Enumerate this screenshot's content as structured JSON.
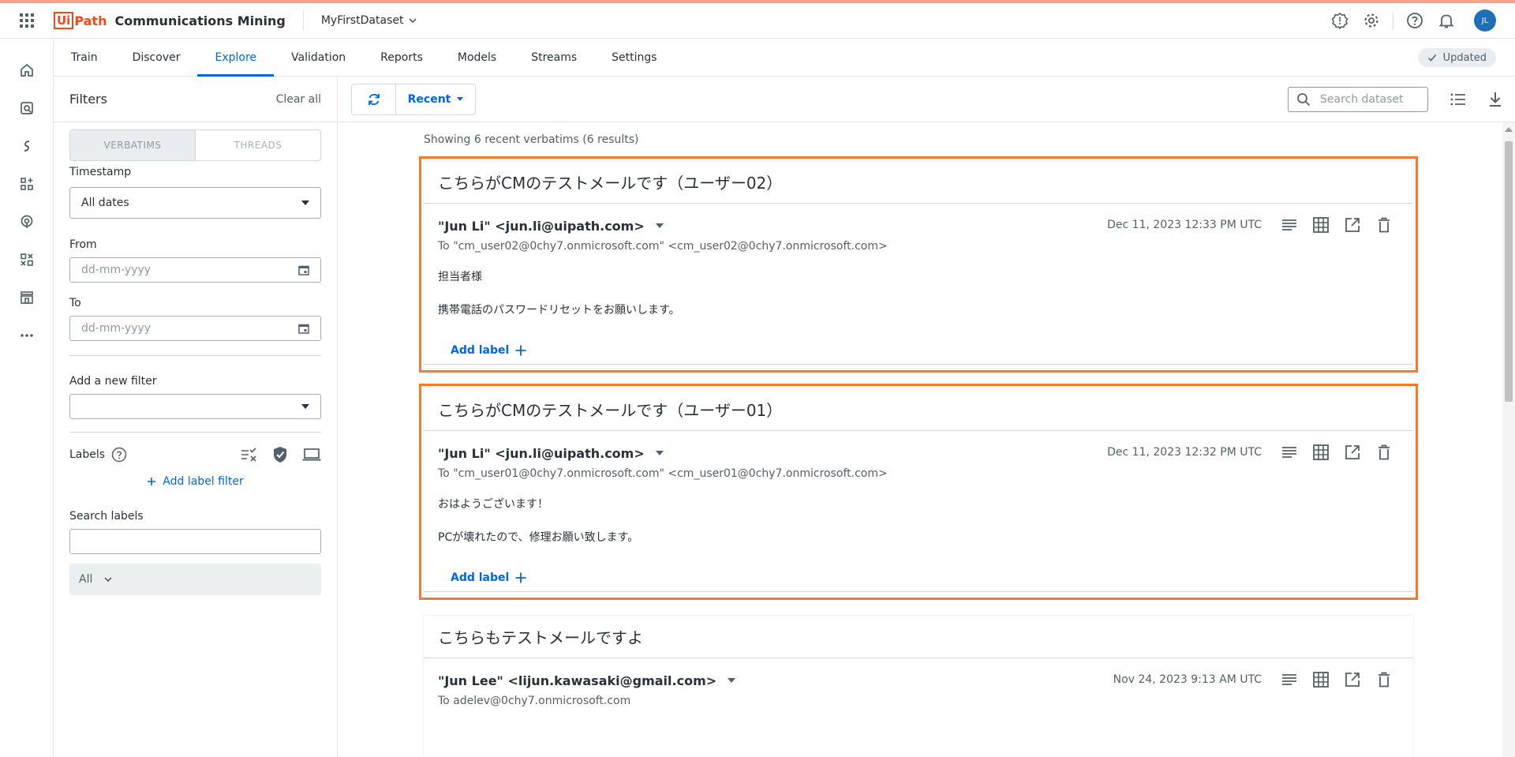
{
  "header": {
    "product_ui": "Ui",
    "product_path": "Path",
    "product_name": "Communications Mining",
    "dataset": "MyFirstDataset",
    "avatar_initials": "JL"
  },
  "tabs": [
    {
      "label": "Train"
    },
    {
      "label": "Discover"
    },
    {
      "label": "Explore",
      "active": true
    },
    {
      "label": "Validation"
    },
    {
      "label": "Reports"
    },
    {
      "label": "Models"
    },
    {
      "label": "Streams"
    },
    {
      "label": "Settings"
    }
  ],
  "status": {
    "updated_label": "Updated"
  },
  "filters": {
    "title": "Filters",
    "clear_all": "Clear all",
    "seg_verbatims": "VERBATIMS",
    "seg_threads": "THREADS",
    "timestamp_label": "Timestamp",
    "timestamp_value": "All dates",
    "from_label": "From",
    "from_placeholder": "dd-mm-yyyy",
    "to_label": "To",
    "to_placeholder": "dd-mm-yyyy",
    "add_filter_label": "Add a new filter",
    "labels_label": "Labels",
    "add_label_filter": "Add label filter",
    "search_labels_label": "Search labels",
    "all_label": "All"
  },
  "toolbar": {
    "recent_label": "Recent",
    "search_placeholder": "Search dataset"
  },
  "results": {
    "showing_text": "Showing 6 recent verbatims (6 results)",
    "add_label_text": "Add label",
    "cards": [
      {
        "subject": "こちらがCMのテストメールです（ユーザー02）",
        "sender": "\"Jun Li\" <jun.li@uipath.com>",
        "date": "Dec 11, 2023 12:33 PM UTC",
        "to": "To \"cm_user02@0chy7.onmicrosoft.com\" <cm_user02@0chy7.onmicrosoft.com>",
        "body1": "担当者様",
        "body2": "携帯電話のパスワードリセットをお願いします。"
      },
      {
        "subject": "こちらがCMのテストメールです（ユーザー01）",
        "sender": "\"Jun Li\" <jun.li@uipath.com>",
        "date": "Dec 11, 2023 12:32 PM UTC",
        "to": "To \"cm_user01@0chy7.onmicrosoft.com\" <cm_user01@0chy7.onmicrosoft.com>",
        "body1": "おはようございます！",
        "body2": "PCが壊れたので、修理お願い致します。"
      },
      {
        "subject": "こちらもテストメールですよ",
        "sender": "\"Jun Lee\" <lijun.kawasaki@gmail.com>",
        "date": "Nov 24, 2023 9:13 AM UTC",
        "to": "To adelev@0chy7.onmicrosoft.com"
      }
    ]
  },
  "colors": {
    "accent": "#0067df",
    "brand": "#fa4616",
    "highlight": "#f47b2a"
  }
}
